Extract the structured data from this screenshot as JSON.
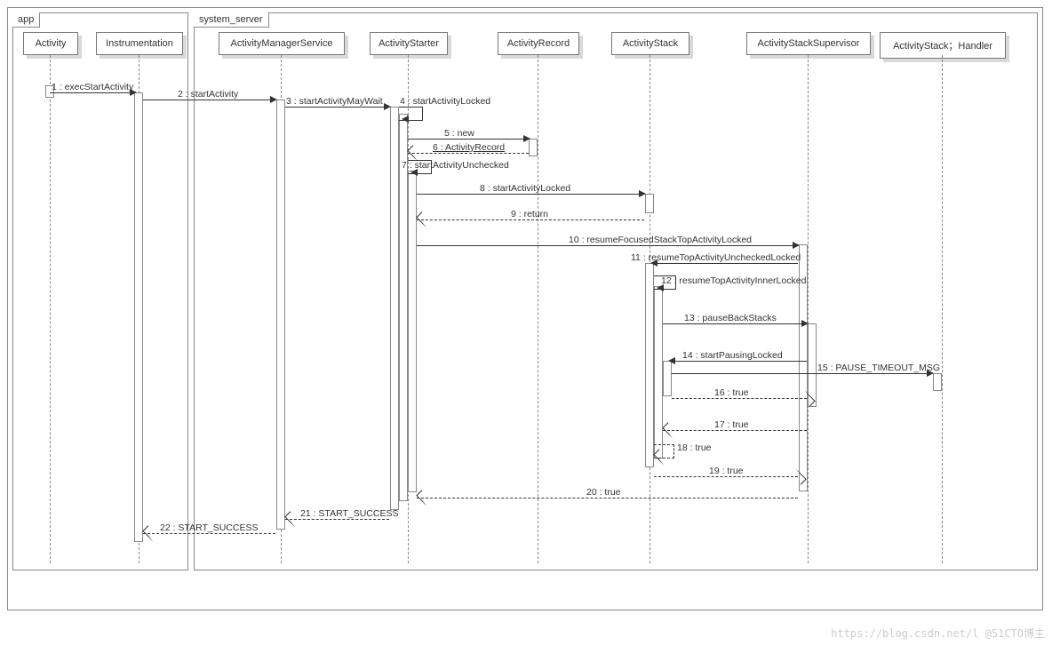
{
  "chart_data": {
    "type": "sequence-diagram",
    "groups": [
      {
        "name": "app",
        "participants": [
          "Activity",
          "Instrumentation"
        ]
      },
      {
        "name": "system_server",
        "participants": [
          "ActivityManagerService",
          "ActivityStarter",
          "ActivityRecord",
          "ActivityStack",
          "ActivityStackSupervisor",
          "ActivityStack；Handler"
        ]
      }
    ],
    "participants": [
      "Activity",
      "Instrumentation",
      "ActivityManagerService",
      "ActivityStarter",
      "ActivityRecord",
      "ActivityStack",
      "ActivityStackSupervisor",
      "ActivityStack；Handler"
    ],
    "messages": [
      {
        "n": 1,
        "from": "Activity",
        "to": "Instrumentation",
        "label": "execStartActivity",
        "type": "call"
      },
      {
        "n": 2,
        "from": "Instrumentation",
        "to": "ActivityManagerService",
        "label": "startActivity",
        "type": "call"
      },
      {
        "n": 3,
        "from": "ActivityManagerService",
        "to": "ActivityStarter",
        "label": "startActivityMayWait",
        "type": "call"
      },
      {
        "n": 4,
        "from": "ActivityStarter",
        "to": "ActivityStarter",
        "label": "startActivityLocked",
        "type": "self"
      },
      {
        "n": 5,
        "from": "ActivityStarter",
        "to": "ActivityRecord",
        "label": "new",
        "type": "call"
      },
      {
        "n": 6,
        "from": "ActivityRecord",
        "to": "ActivityStarter",
        "label": "ActivityRecord",
        "type": "return"
      },
      {
        "n": 7,
        "from": "ActivityStarter",
        "to": "ActivityStarter",
        "label": "startActivityUnchecked",
        "type": "self"
      },
      {
        "n": 8,
        "from": "ActivityStarter",
        "to": "ActivityStack",
        "label": "startActivityLocked",
        "type": "call"
      },
      {
        "n": 9,
        "from": "ActivityStack",
        "to": "ActivityStarter",
        "label": "return",
        "type": "return"
      },
      {
        "n": 10,
        "from": "ActivityStarter",
        "to": "ActivityStackSupervisor",
        "label": "resumeFocusedStackTopActivityLocked",
        "type": "call"
      },
      {
        "n": 11,
        "from": "ActivityStackSupervisor",
        "to": "ActivityStack",
        "label": "resumeTopActivityUncheckedLocked",
        "type": "call"
      },
      {
        "n": 12,
        "from": "ActivityStack",
        "to": "ActivityStack",
        "label": "resumeTopActivityInnerLocked",
        "type": "self"
      },
      {
        "n": 13,
        "from": "ActivityStack",
        "to": "ActivityStackSupervisor",
        "label": "pauseBackStacks",
        "type": "call"
      },
      {
        "n": 14,
        "from": "ActivityStackSupervisor",
        "to": "ActivityStack",
        "label": "startPausingLocked",
        "type": "call"
      },
      {
        "n": 15,
        "from": "ActivityStack",
        "to": "ActivityStack；Handler",
        "label": "PAUSE_TIMEOUT_MSG",
        "type": "call"
      },
      {
        "n": 16,
        "from": "ActivityStack",
        "to": "ActivityStackSupervisor",
        "label": "true",
        "type": "return"
      },
      {
        "n": 17,
        "from": "ActivityStackSupervisor",
        "to": "ActivityStack",
        "label": "true",
        "type": "return"
      },
      {
        "n": 18,
        "from": "ActivityStack",
        "to": "ActivityStack",
        "label": "true",
        "type": "return-self"
      },
      {
        "n": 19,
        "from": "ActivityStack",
        "to": "ActivityStackSupervisor",
        "label": "true",
        "type": "return"
      },
      {
        "n": 20,
        "from": "ActivityStackSupervisor",
        "to": "ActivityStarter",
        "label": "true",
        "type": "return"
      },
      {
        "n": 21,
        "from": "ActivityStarter",
        "to": "ActivityManagerService",
        "label": "START_SUCCESS",
        "type": "return"
      },
      {
        "n": 22,
        "from": "ActivityManagerService",
        "to": "Instrumentation",
        "label": "START_SUCCESS",
        "type": "return"
      }
    ]
  },
  "labels": {
    "group_app": "app",
    "group_system": "system_server",
    "actors": {
      "activity": "Activity",
      "instrumentation": "Instrumentation",
      "ams": "ActivityManagerService",
      "starter": "ActivityStarter",
      "record": "ActivityRecord",
      "stack": "ActivityStack",
      "supervisor": "ActivityStackSupervisor",
      "handler": "ActivityStack；Handler"
    },
    "msgs": {
      "m1": "1 : execStartActivity",
      "m2": "2 : startActivity",
      "m3": "3 : startActivityMayWait",
      "m4": "4 : startActivityLocked",
      "m5": "5 : new",
      "m6": "6 : ActivityRecord",
      "m7": "7 : startActivityUnchecked",
      "m8": "8 : startActivityLocked",
      "m9": "9 : return",
      "m10": "10 : resumeFocusedStackTopActivityLocked",
      "m11": "11 : resumeTopActivityUncheckedLocked",
      "m12": "12 : resumeTopActivityInnerLocked",
      "m13": "13 : pauseBackStacks",
      "m14": "14 : startPausingLocked",
      "m15": "15 : PAUSE_TIMEOUT_MSG",
      "m16": "16 : true",
      "m17": "17 : true",
      "m18": "18 : true",
      "m19": "19 : true",
      "m20": "20 : true",
      "m21": "21 : START_SUCCESS",
      "m22": "22 : START_SUCCESS"
    },
    "watermark": "https://blog.csdn.net/l  @51CTO博主"
  }
}
